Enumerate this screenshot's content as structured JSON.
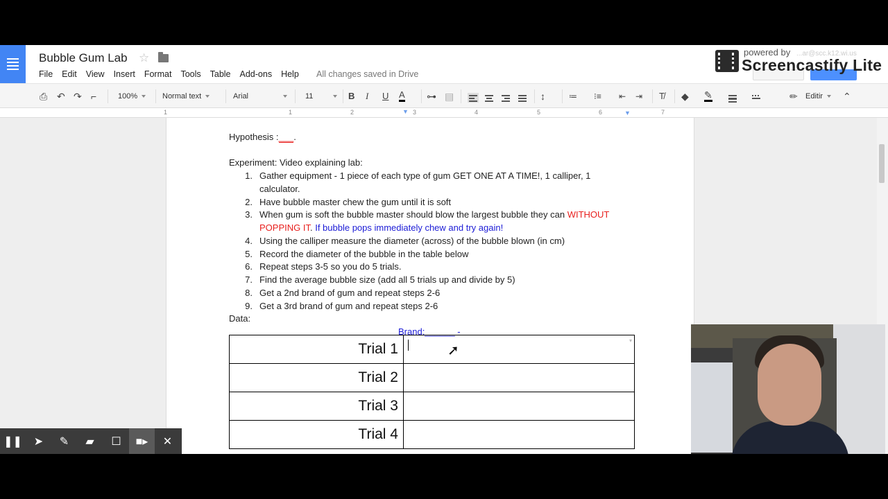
{
  "header": {
    "doc_title": "Bubble Gum Lab",
    "menu": [
      "File",
      "Edit",
      "View",
      "Insert",
      "Format",
      "Tools",
      "Table",
      "Add-ons",
      "Help"
    ],
    "save_status": "All changes saved in Drive",
    "account_email": "...ar@scc.k12.wi.us"
  },
  "watermark": {
    "powered_by": "powered by",
    "name": "Screencastify Lite"
  },
  "toolbar": {
    "zoom": "100%",
    "style": "Normal text",
    "font": "Arial",
    "size": "11",
    "bold": "B",
    "italic": "I",
    "underline": "U",
    "text_color": "A",
    "editing_mode": "Editir"
  },
  "ruler": {
    "labels": [
      "1",
      "1",
      "2",
      "3",
      "4",
      "5",
      "6",
      "7"
    ]
  },
  "document": {
    "hypothesis_label": "Hypothesis :",
    "hypothesis_blank": "___",
    "experiment_label": "Experiment: Video explaining lab:",
    "steps": [
      {
        "num": "1.",
        "text": "Gather equipment - 1 piece of each type of gum GET ONE AT A TIME!, 1 calliper, 1",
        "cont": "calculator."
      },
      {
        "num": "2.",
        "text": "Have bubble master chew the gum until it is soft"
      },
      {
        "num": "3.",
        "text": "When gum is soft the bubble master should blow the largest bubble they can ",
        "red": "WITHOUT",
        "red2": "POPPING IT",
        "blue": "If bubble pops immediately chew and try again!"
      },
      {
        "num": "4.",
        "text": "Using the calliper measure the diameter (across) of the bubble blown (in cm)"
      },
      {
        "num": "5.",
        "text": "Record the diameter of the bubble in the table below"
      },
      {
        "num": "6.",
        "text": "Repeat steps 3-5 so you do 5 trials."
      },
      {
        "num": "7.",
        "text": "Find the average bubble size (add all 5 trials up and divide by 5)"
      },
      {
        "num": "8.",
        "text": "Get a 2nd brand of gum and repeat steps 2-6"
      },
      {
        "num": "9.",
        "text": "Get a 3rd brand of gum and repeat steps 2-6"
      }
    ],
    "data_label": "Data:",
    "brand_line": "Brand:______ -",
    "table": {
      "rows": [
        {
          "label": "Trial 1",
          "value": ""
        },
        {
          "label": "Trial 2",
          "value": ""
        },
        {
          "label": "Trial 3",
          "value": ""
        },
        {
          "label": "Trial 4",
          "value": ""
        }
      ]
    }
  },
  "recorder": {
    "buttons": [
      "pause",
      "pointer",
      "pen",
      "highlighter",
      "rectangle",
      "camera",
      "close"
    ]
  },
  "colors": {
    "docs_blue": "#4285f4",
    "red_text": "#e8201e",
    "blue_text": "#1c1cd6",
    "share_blue": "#4d90fe"
  }
}
